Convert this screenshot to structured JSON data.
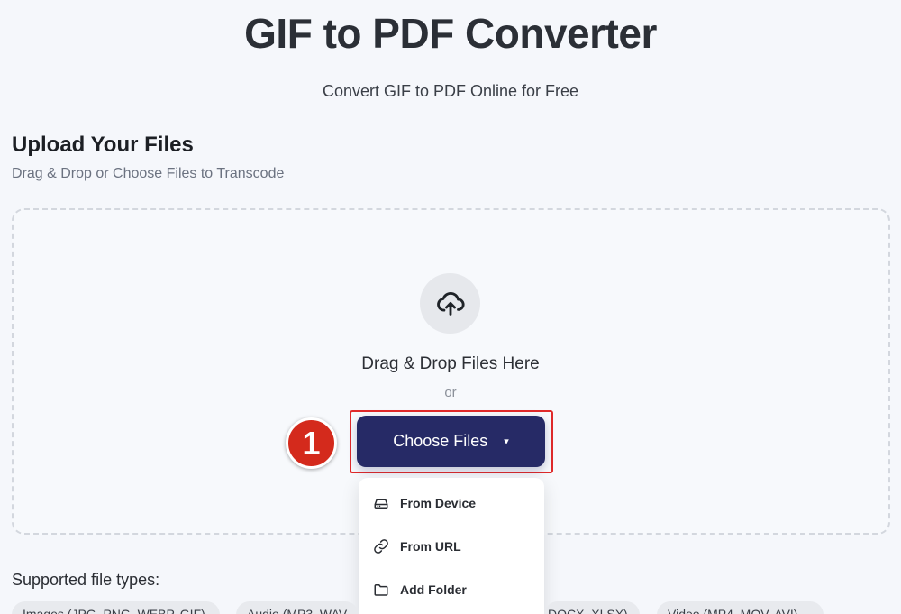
{
  "header": {
    "title": "GIF to PDF Converter",
    "subtitle": "Convert GIF to PDF Online for Free"
  },
  "upload": {
    "title": "Upload Your Files",
    "subtitle": "Drag & Drop or Choose Files to Transcode",
    "drop_text": "Drag & Drop Files Here",
    "or_text": "or",
    "choose_label": "Choose Files",
    "caret": "▾",
    "step_number": "1"
  },
  "dropdown": {
    "items": [
      {
        "label": "From Device",
        "icon": "drive-icon"
      },
      {
        "label": "From URL",
        "icon": "link-icon"
      },
      {
        "label": "Add Folder",
        "icon": "folder-icon"
      }
    ]
  },
  "supported": {
    "label": "Supported file types:",
    "chips": [
      "Images (JPG, PNG, WEBP, GIF)",
      "Audio (MP3, WAV",
      "DOCX, XLSX)",
      "Video (MP4, MOV, AVI)"
    ]
  },
  "colors": {
    "button": "#262a66",
    "highlight": "#e02a2a",
    "badge": "#d42a1c"
  }
}
